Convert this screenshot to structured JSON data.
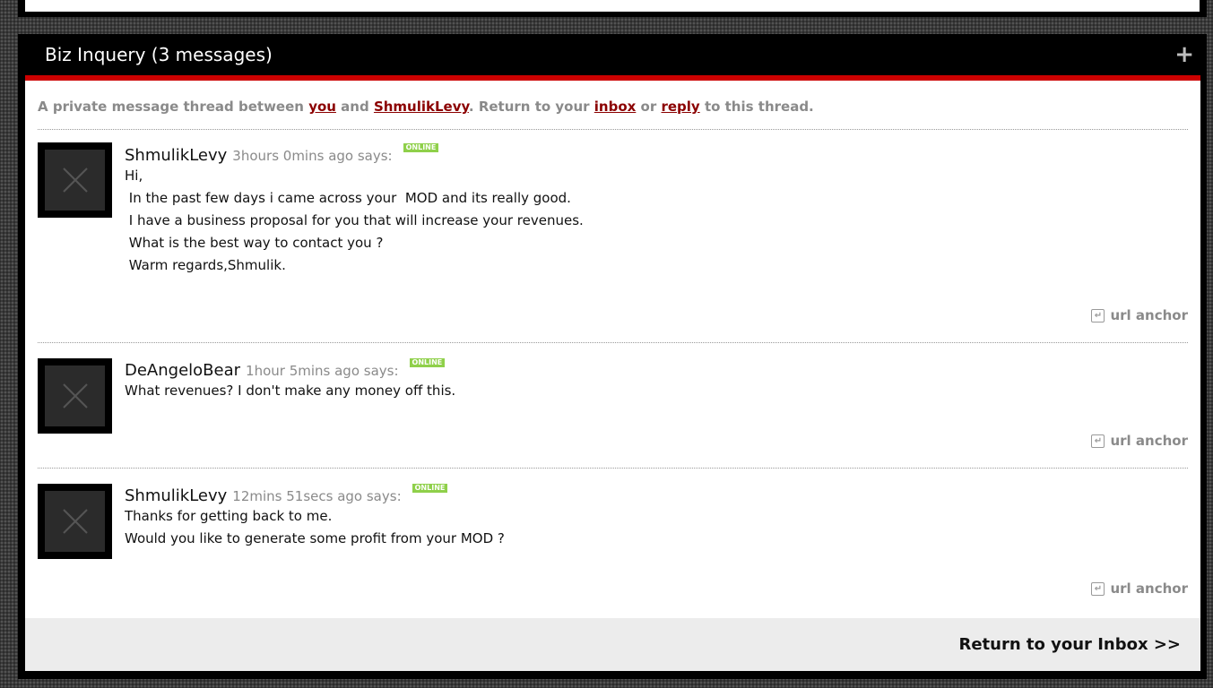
{
  "thread": {
    "title": "Biz Inquery  (3 messages)",
    "expand_symbol": "+"
  },
  "intro": {
    "part1": "A private message thread between ",
    "you_link": "you",
    "and": " and ",
    "user_link": "ShmulikLevy",
    "part2": ". Return to your ",
    "inbox_link": "inbox",
    "or": " or ",
    "reply_link": "reply",
    "part3": " to this thread."
  },
  "messages": [
    {
      "author": "ShmulikLevy",
      "ago": "3hours 0mins ago says:",
      "status": "ONLINE",
      "lines": [
        "Hi,",
        " In the past few days i came across your  MOD and its really good.",
        " I have a business proposal for you that will increase your revenues.",
        " What is the best way to contact you ?",
        " Warm regards,Shmulik."
      ],
      "anchor_label": "url anchor"
    },
    {
      "author": "DeAngeloBear",
      "ago": "1hour 5mins ago says:",
      "status": "ONLINE",
      "lines": [
        "What revenues? I don't make any money off this."
      ],
      "anchor_label": "url anchor"
    },
    {
      "author": "ShmulikLevy",
      "ago": "12mins 51secs ago says:",
      "status": "ONLINE",
      "lines": [
        "Thanks for getting back to me.",
        "Would you like to generate some profit from your MOD ?"
      ],
      "anchor_label": "url anchor"
    }
  ],
  "footer": {
    "return_label": "Return to your Inbox >>"
  },
  "colors": {
    "accent_red": "#cc0000",
    "link_red": "#8b0000",
    "online_green": "#8fd04a"
  },
  "icons": {
    "avatar": "placeholder-x-icon",
    "anchor": "return-anchor-icon",
    "expand": "plus-icon"
  }
}
